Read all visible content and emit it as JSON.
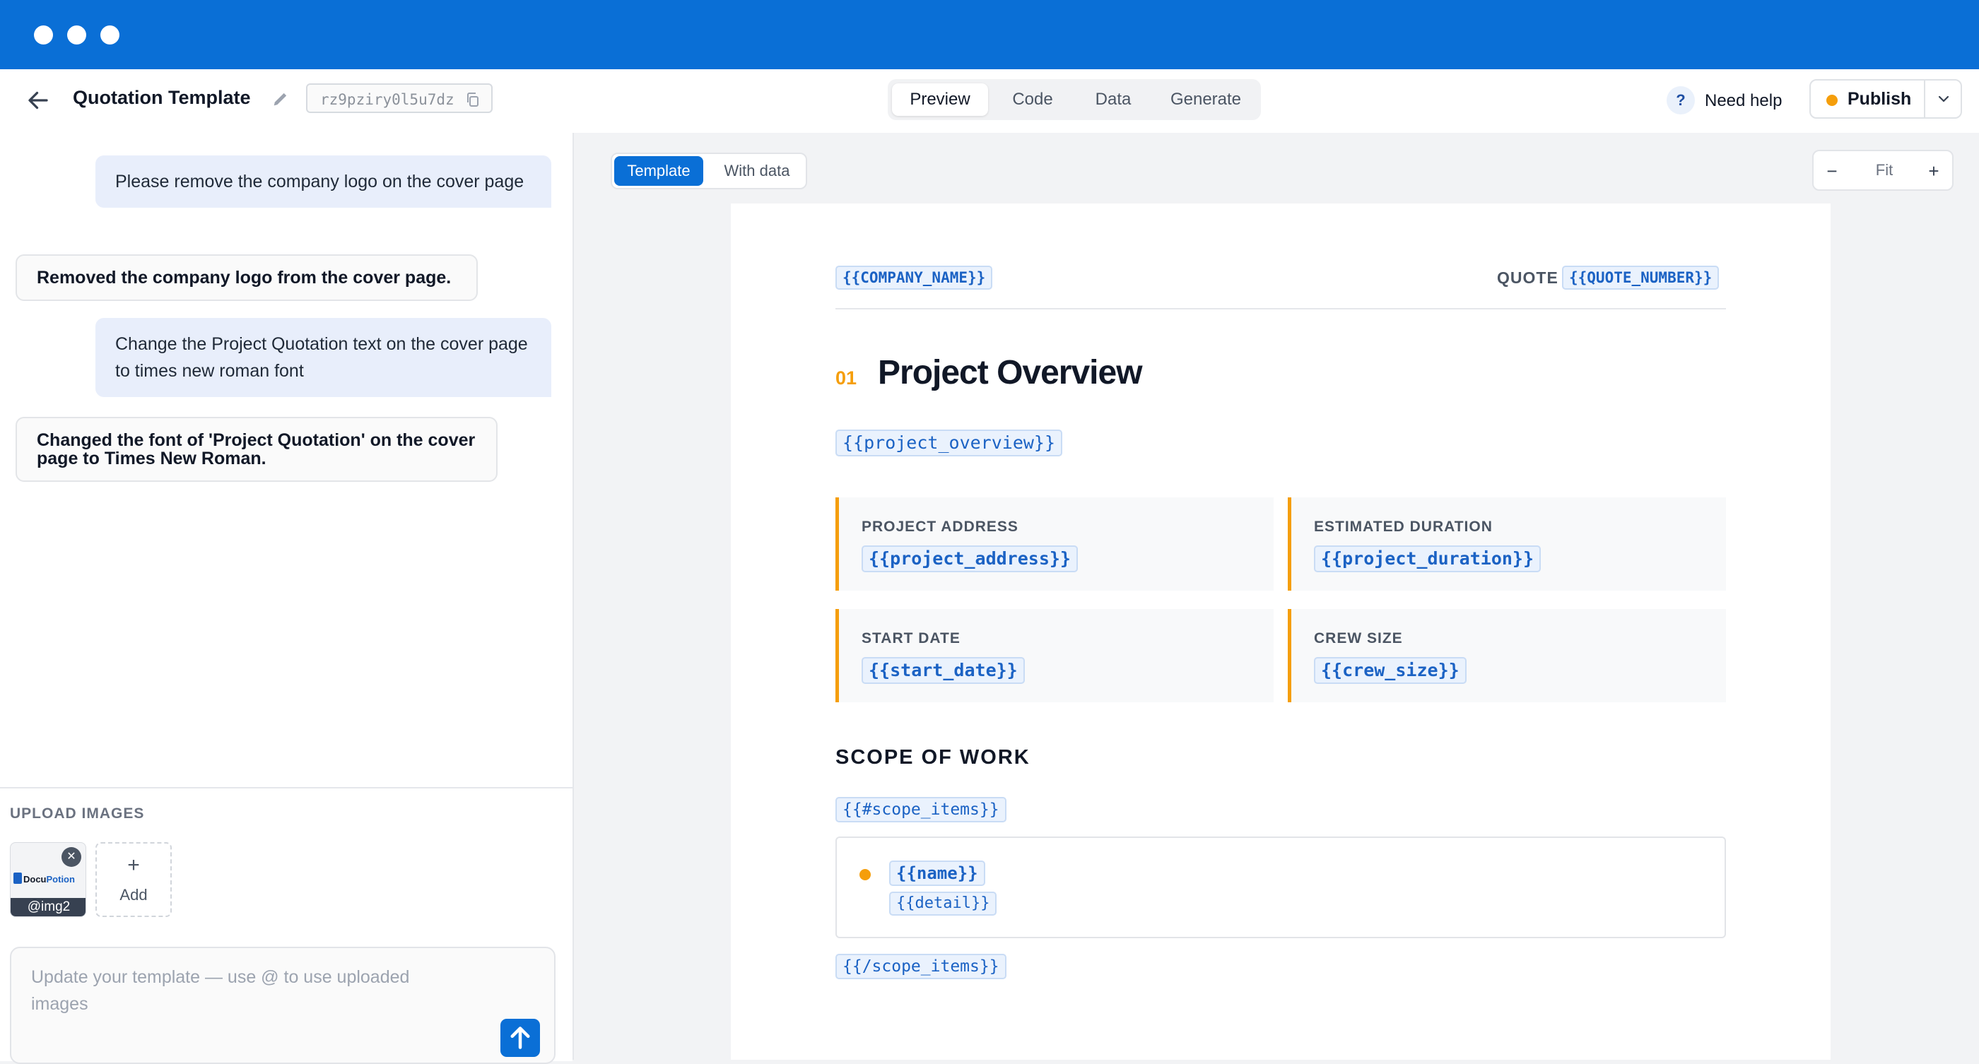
{
  "header": {
    "title": "Quotation Template",
    "template_id": "rz9pziry0l5u7dz",
    "tabs": [
      {
        "label": "Preview",
        "active": true
      },
      {
        "label": "Code",
        "active": false
      },
      {
        "label": "Data",
        "active": false
      },
      {
        "label": "Generate",
        "active": false
      }
    ],
    "help_label": "Need help",
    "publish_label": "Publish",
    "colors": {
      "titlebar": "#0a6fd6",
      "accent": "#f59e0b"
    }
  },
  "chat": {
    "messages": [
      {
        "role": "user",
        "text": "Please remove the company logo on the cover page"
      },
      {
        "role": "assistant",
        "text": "Removed the company logo from the cover page."
      },
      {
        "role": "user",
        "text": "Change the Project Quotation text on the cover page to times new roman font"
      },
      {
        "role": "assistant",
        "text": "Changed the font of 'Project Quotation' on the cover page to Times New Roman."
      }
    ]
  },
  "upload": {
    "title": "UPLOAD IMAGES",
    "images": [
      {
        "caption": "@img2",
        "logo_text_a": "Docu",
        "logo_text_b": "Potion"
      }
    ],
    "add_label": "Add",
    "add_icon": "+"
  },
  "composer": {
    "placeholder": "Update your template — use @ to use uploaded images",
    "send_icon": "arrow-up-icon"
  },
  "preview": {
    "mode_template": "Template",
    "mode_data": "With data",
    "zoom_label": "Fit",
    "zoom_out": "−",
    "zoom_in": "+"
  },
  "document": {
    "company": "{{COMPANY_NAME}}",
    "quote_label": "QUOTE",
    "quote_number": "{{QUOTE_NUMBER}}",
    "section_number": "01",
    "section_title": "Project Overview",
    "overview": "{{project_overview}}",
    "cards": [
      {
        "label": "PROJECT ADDRESS",
        "value": "{{project_address}}"
      },
      {
        "label": "ESTIMATED DURATION",
        "value": "{{project_duration}}"
      },
      {
        "label": "START DATE",
        "value": "{{start_date}}"
      },
      {
        "label": "CREW SIZE",
        "value": "{{crew_size}}"
      }
    ],
    "scope_title": "SCOPE OF WORK",
    "scope_open": "{{#scope_items}}",
    "scope_item_name": "{{name}}",
    "scope_item_detail": "{{detail}}",
    "scope_close": "{{/scope_items}}"
  }
}
